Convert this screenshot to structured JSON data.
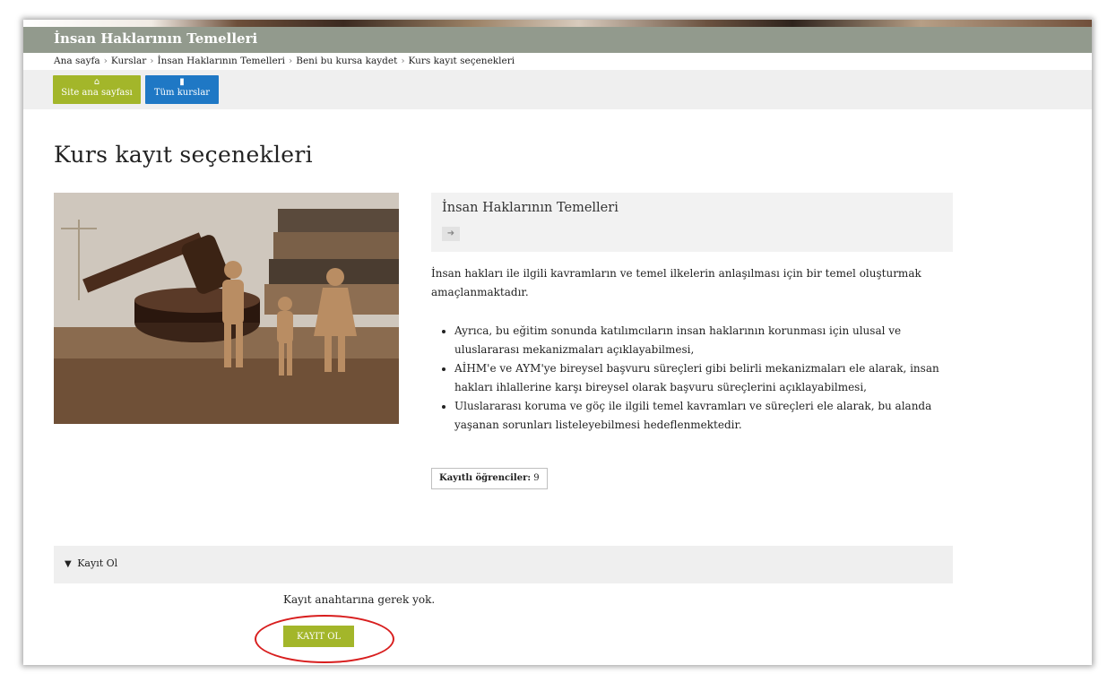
{
  "header": {
    "course_title": "İnsan Haklarının Temelleri"
  },
  "breadcrumb": {
    "separator": "›",
    "items": [
      "Ana sayfa",
      "Kurslar",
      "İnsan Haklarının Temelleri",
      "Beni bu kursa kaydet",
      "Kurs kayıt seçenekleri"
    ]
  },
  "nav": {
    "home_label": "Site ana sayfası",
    "home_icon": "home-icon",
    "courses_label": "Tüm kurslar",
    "courses_icon": "book-icon",
    "home_color": "#a3b62a",
    "courses_color": "#1f78c5"
  },
  "page": {
    "heading": "Kurs kayıt seçenekleri"
  },
  "course": {
    "name": "İnsan Haklarının Temelleri",
    "enrol_icon": "sign-in-icon",
    "summary_intro": "İnsan hakları ile ilgili kavramların ve temel ilkelerin anlaşılması için bir temel oluşturmak amaçlanmaktadır.",
    "goals": [
      "Ayrıca, bu eğitim sonunda katılımcıların insan haklarının korunması için ulusal ve uluslararası mekanizmaları açıklayabilmesi,",
      "AİHM'e ve AYM'ye bireysel başvuru süreçleri gibi belirli mekanizmaları ele alarak, insan hakları ihlallerine karşı bireysel olarak başvuru süreçlerini açıklayabilmesi,",
      "Uluslararası koruma ve göç ile ilgili temel kavramları ve süreçleri ele alarak, bu alanda yaşanan sorunları listeleyebilmesi hedeflenmektedir."
    ],
    "enrolled_label": "Kayıtlı öğrenciler:",
    "enrolled_count": "9"
  },
  "enrol_section": {
    "title": "Kayıt Ol",
    "no_key_text": "Kayıt anahtarına gerek yok.",
    "button_label": "KAYIT OL",
    "accent_color": "#a3b62a",
    "highlight_color": "#d81e1e"
  }
}
